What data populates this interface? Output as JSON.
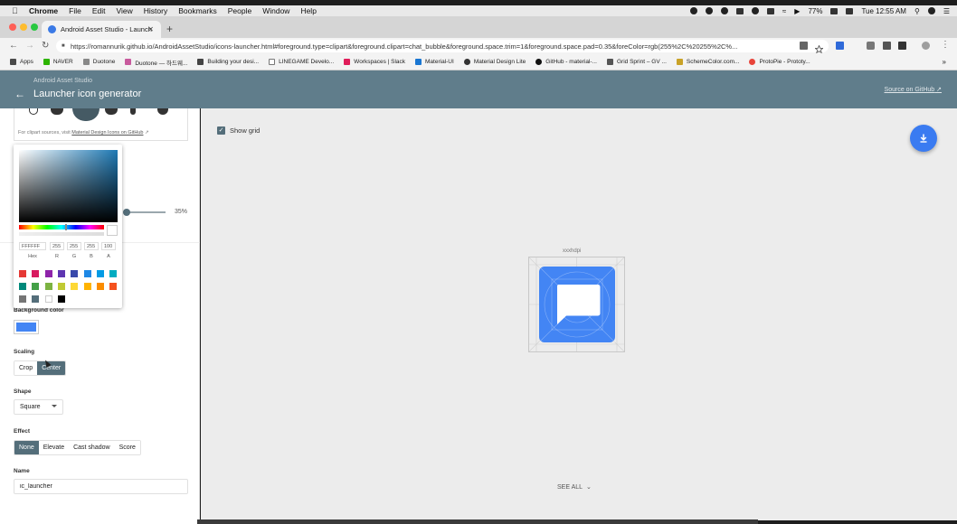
{
  "menubar": {
    "app_name": "Chrome",
    "items": [
      "File",
      "Edit",
      "View",
      "History",
      "Bookmarks",
      "People",
      "Window",
      "Help"
    ],
    "battery": "77%",
    "clock": "Tue 12:55 AM"
  },
  "browser": {
    "tab_title": "Android Asset Studio - Launch",
    "url": "https://romannurik.github.io/AndroidAssetStudio/icons-launcher.html#foreground.type=clipart&foreground.clipart=chat_bubble&foreground.space.trim=1&foreground.space.pad=0.35&foreColor=rgb(255%2C%20255%2C%...",
    "bookmarks": [
      "Apps",
      "NAVER",
      "Duotone",
      "Duotone — 하드웨...",
      "Building your desi...",
      "LINEGAME Develo...",
      "Workspaces | Slack",
      "Material-UI",
      "Material Design Lite",
      "GitHub - material-...",
      "Grid Sprint – GV ...",
      "SchemeColor.com...",
      "ProtoPie - Prototy..."
    ]
  },
  "appbar": {
    "subtitle": "Android Asset Studio",
    "title": "Launcher icon generator",
    "source_link": "Source on GitHub"
  },
  "left_panel": {
    "clipart_note": "For clipart sources, visit",
    "clipart_link": "Material Design Icons on GitHub",
    "padding_value": "35%",
    "background_color_label": "Background color",
    "background_color": "#4385f4",
    "scaling": {
      "label": "Scaling",
      "options": [
        "Crop",
        "Center"
      ],
      "selected": "Center"
    },
    "shape": {
      "label": "Shape",
      "value": "Square"
    },
    "effect": {
      "label": "Effect",
      "options": [
        "None",
        "Elevate",
        "Cast shadow",
        "Score"
      ],
      "selected": "None"
    },
    "name": {
      "label": "Name",
      "value": "ic_launcher"
    }
  },
  "color_picker": {
    "hex": "FFFFFF",
    "r": "255",
    "g": "255",
    "b": "255",
    "a": "100",
    "labels": [
      "Hex",
      "R",
      "G",
      "B",
      "A"
    ],
    "swatches": [
      "#e53935",
      "#d81b60",
      "#8e24aa",
      "#5e35b1",
      "#3949ab",
      "#1e88e5",
      "#039be5",
      "#00acc1",
      "#00897b",
      "#43a047",
      "#7cb342",
      "#c0ca33",
      "#fdd835",
      "#ffb300",
      "#fb8c00",
      "#f4511e",
      "#757575",
      "#546e7a",
      "#ffffff",
      "#000000"
    ]
  },
  "canvas": {
    "show_grid_label": "Show grid",
    "show_grid_checked": true,
    "density_label": "xxxhdpi",
    "icon_background": "#4385f4",
    "see_all": "SEE ALL"
  }
}
